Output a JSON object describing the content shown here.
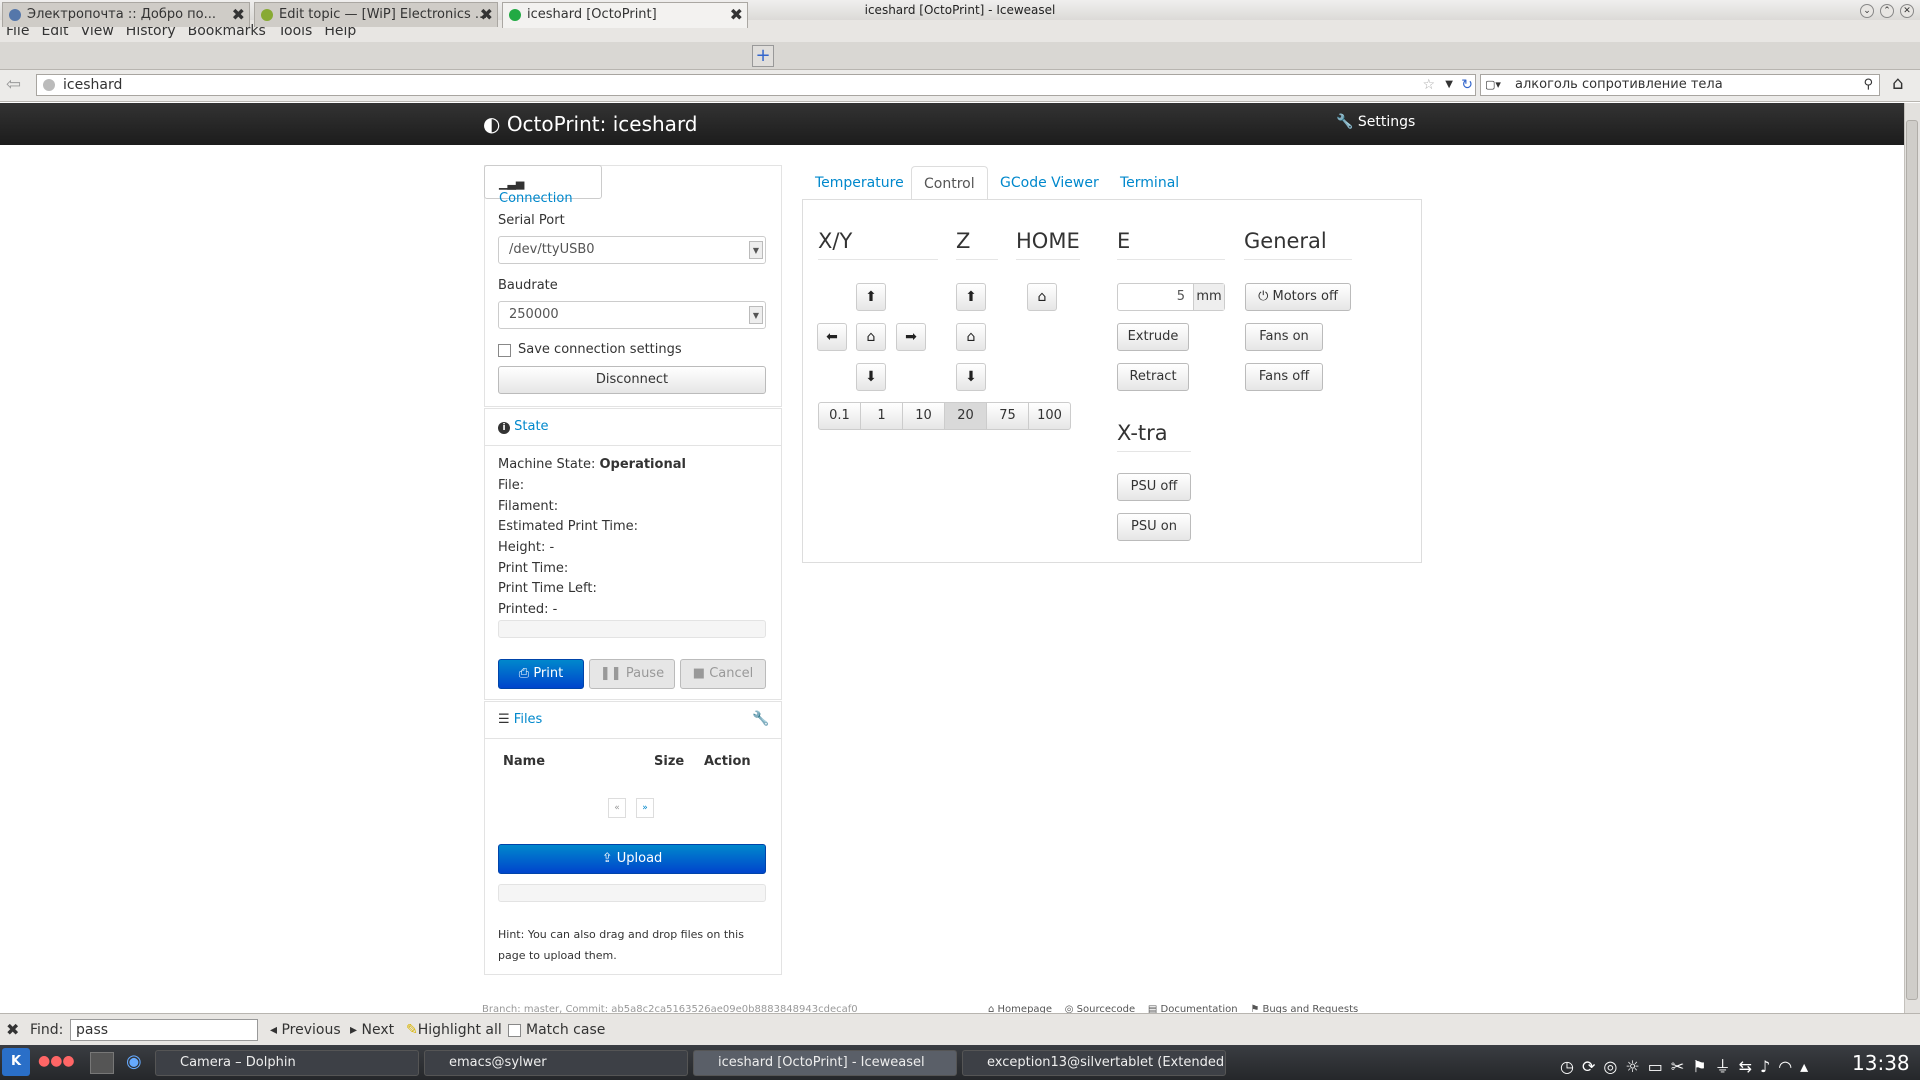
{
  "window": {
    "title": "iceshard [OctoPrint] - Iceweasel"
  },
  "menu": [
    "File",
    "Edit",
    "View",
    "History",
    "Bookmarks",
    "Tools",
    "Help"
  ],
  "tabs": [
    {
      "label": "Электропочта :: Добро по..."
    },
    {
      "label": "Edit topic — [WiP] Electronics ..."
    },
    {
      "label": "iceshard [OctoPrint]"
    }
  ],
  "url": "iceshard",
  "search_value": "алкоголь сопротивление тела",
  "octoprint": {
    "brand": "OctoPrint: iceshard",
    "settings": "Settings"
  },
  "connection": {
    "title": "Connection",
    "serial_label": "Serial Port",
    "serial_value": "/dev/ttyUSB0",
    "baud_label": "Baudrate",
    "baud_value": "250000",
    "save_label": "Save connection settings",
    "disconnect": "Disconnect"
  },
  "state": {
    "title": "State",
    "machine_label": "Machine State:",
    "machine_value": "Operational",
    "file": "File:",
    "filament": "Filament:",
    "est": "Estimated Print Time:",
    "height": "Height: -",
    "print_time": "Print Time:",
    "left": "Print Time Left:",
    "printed": "Printed: -",
    "progress": 0,
    "print": "Print",
    "pause": "Pause",
    "cancel": "Cancel"
  },
  "files": {
    "title": "Files",
    "col_name": "Name",
    "col_size": "Size",
    "col_action": "Action",
    "prev": "«",
    "next": "»",
    "upload": "Upload",
    "hint": "Hint: You can also drag and drop files on this page to upload them."
  },
  "control_tabs": [
    "Temperature",
    "Control",
    "GCode Viewer",
    "Terminal"
  ],
  "control": {
    "xy": "X/Y",
    "z": "Z",
    "home": "HOME",
    "e": "E",
    "general": "General",
    "xtra": "X-tra",
    "distances": [
      "0.1",
      "1",
      "10",
      "20",
      "75",
      "100"
    ],
    "active_distance": "20",
    "e_amount": "5",
    "e_unit": "mm",
    "extrude": "Extrude",
    "retract": "Retract",
    "motors_off": "Motors off",
    "fans_on": "Fans on",
    "fans_off": "Fans off",
    "psu_off": "PSU off",
    "psu_on": "PSU on"
  },
  "footer": {
    "branch": "Branch: master, Commit: ab5a8c2ca5163526ae09e0b8883848943cdecaf0",
    "homepage": "Homepage",
    "sourcecode": "Sourcecode",
    "docs": "Documentation",
    "bugs": "Bugs and Requests"
  },
  "findbar": {
    "label": "Find:",
    "value": "pass",
    "previous": "Previous",
    "next": "Next",
    "highlight": "Highlight all",
    "match": "Match case"
  },
  "taskbar": {
    "tasks": [
      "Camera – Dolphin",
      "emacs@sylwer",
      "iceshard [OctoPrint] - Iceweasel",
      "exception13@silvertablet (Extended"
    ],
    "clock": "13:38"
  }
}
